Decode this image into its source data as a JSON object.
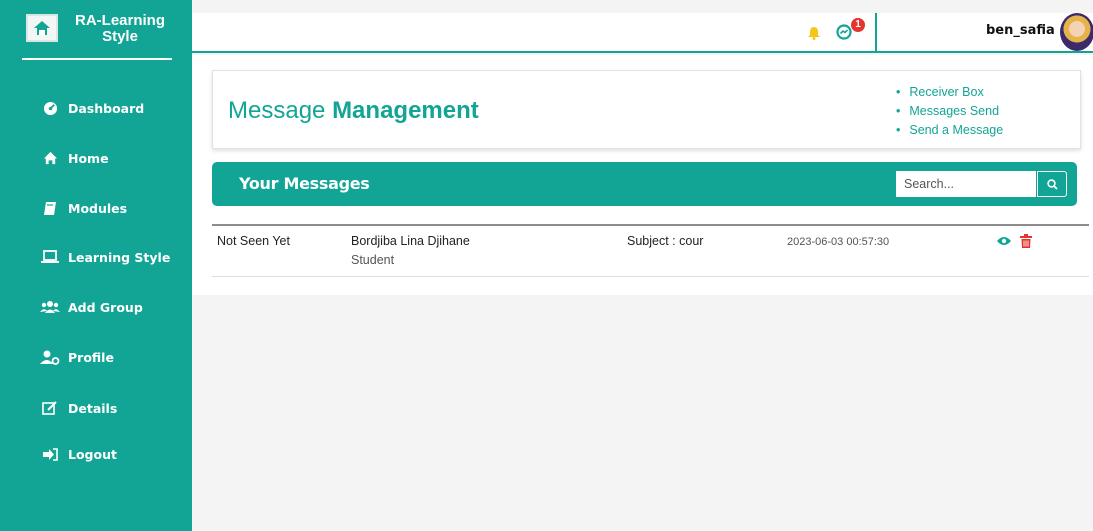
{
  "app": {
    "name": "RA-Learning Style"
  },
  "colors": {
    "primary": "#12a596",
    "danger": "#e3342f",
    "bell": "#f5c518"
  },
  "sidebar": {
    "items": [
      {
        "label": "Dashboard",
        "icon": "dashboard-icon"
      },
      {
        "label": "Home",
        "icon": "home-icon"
      },
      {
        "label": "Modules",
        "icon": "book-icon"
      },
      {
        "label": "Learning Style",
        "icon": "laptop-icon"
      },
      {
        "label": "Add Group",
        "icon": "users-icon"
      },
      {
        "label": "Profile",
        "icon": "user-cog-icon"
      },
      {
        "label": "Details",
        "icon": "edit-icon"
      },
      {
        "label": "Logout",
        "icon": "logout-icon"
      }
    ]
  },
  "topbar": {
    "username": "ben_safia",
    "messages_badge": "1",
    "icons": [
      "bell-icon",
      "messenger-icon",
      "avatar"
    ]
  },
  "header": {
    "title_regular": "Message",
    "title_bold": "Management",
    "links": [
      "Receiver Box",
      "Messages Send",
      "Send a Message"
    ]
  },
  "messages": {
    "title": "Your Messages",
    "search_placeholder": "Search...",
    "rows": [
      {
        "status": "Not Seen Yet",
        "sender": "Bordjiba Lina Djihane",
        "role": "Student",
        "subject": "Subject : cour",
        "date": "2023-06-03 00:57:30",
        "actions": [
          "view-icon",
          "delete-icon"
        ]
      }
    ]
  }
}
